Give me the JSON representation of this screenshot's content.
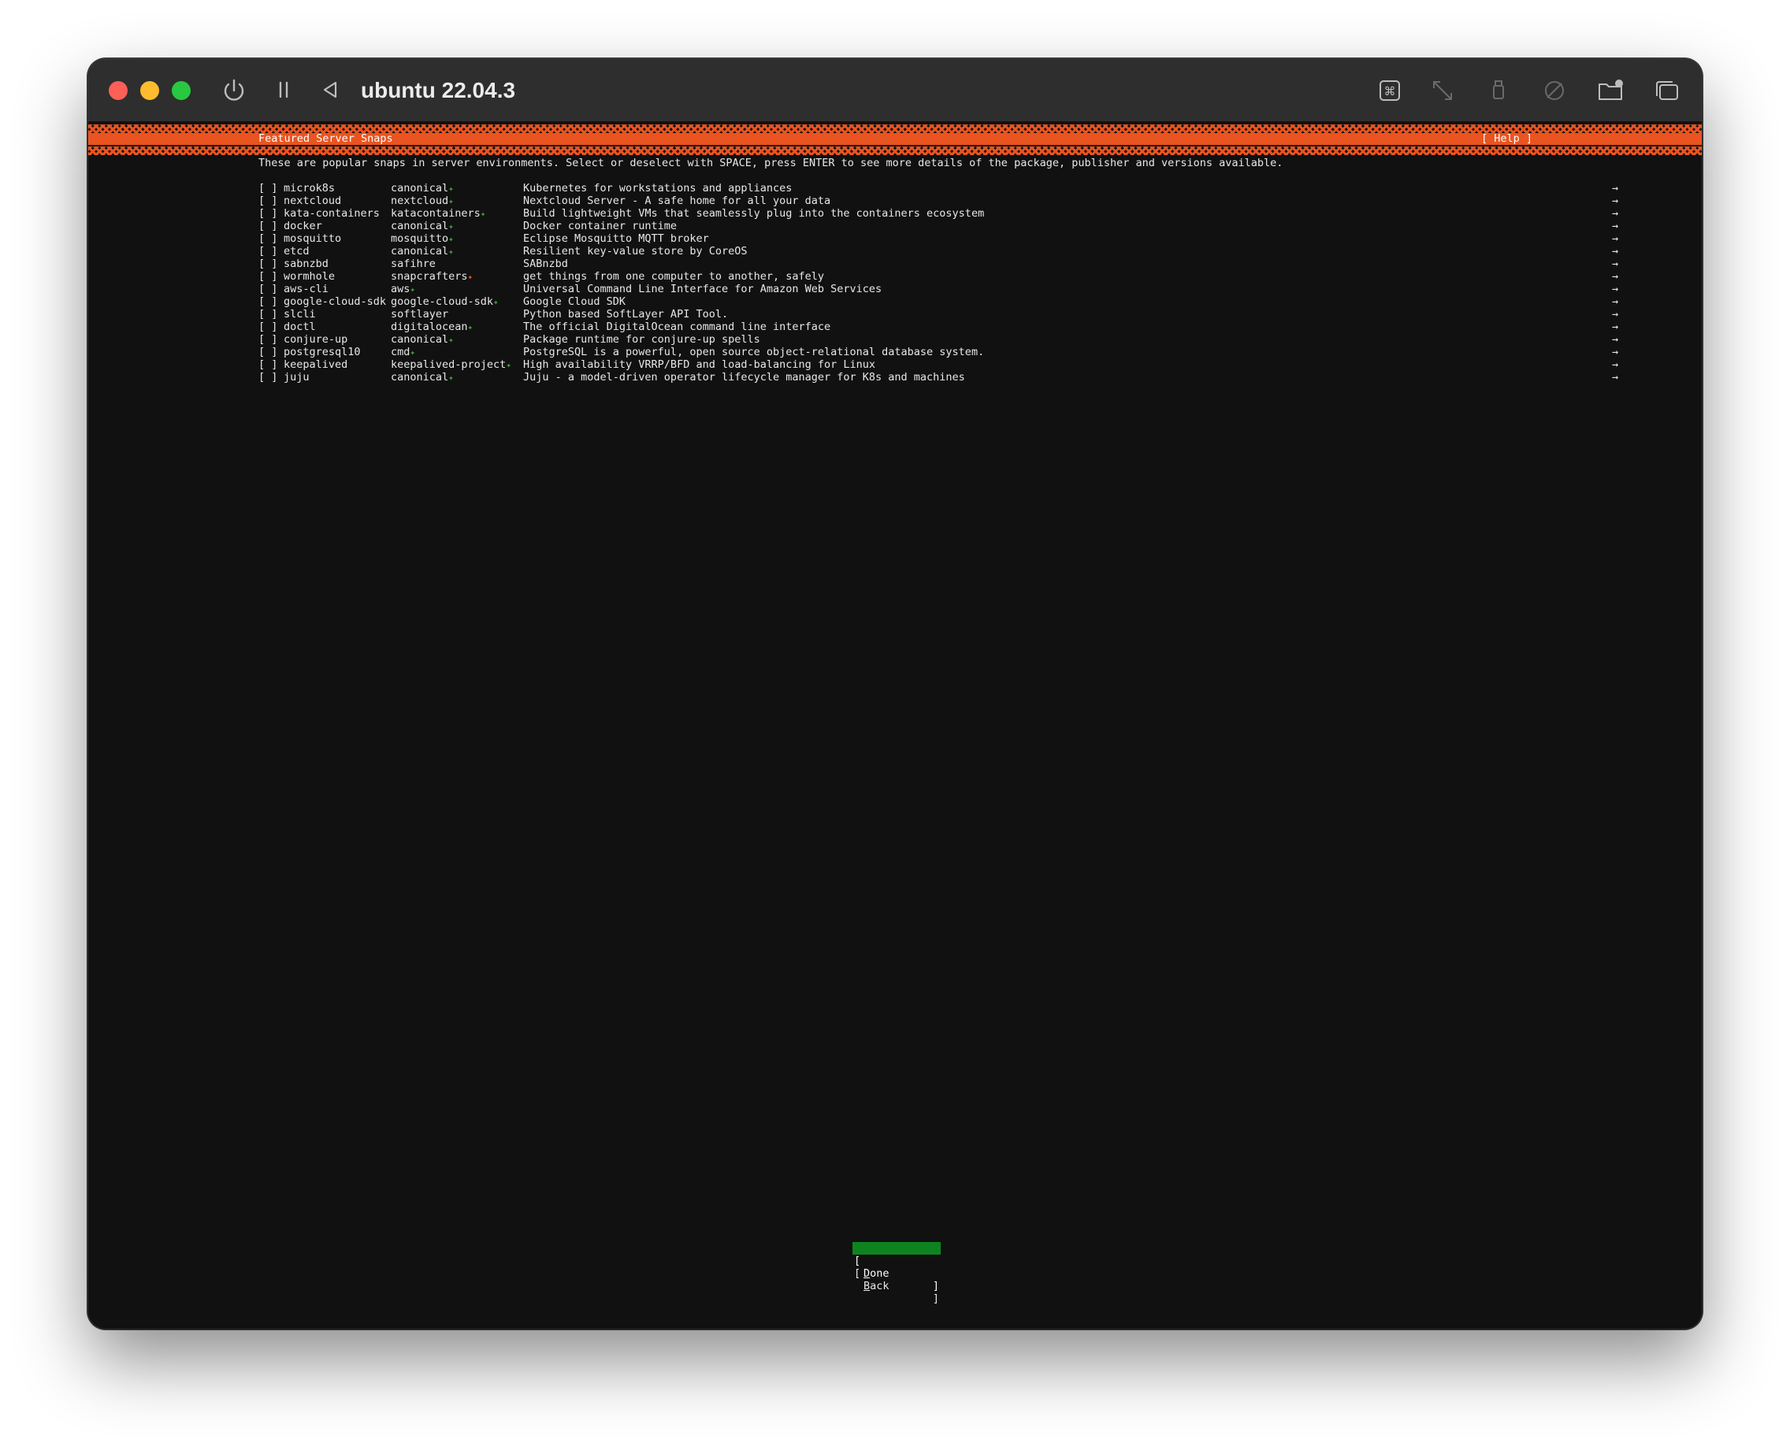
{
  "window": {
    "title": "ubuntu 22.04.3",
    "toolbar_icons": [
      "power-icon",
      "pause-icon",
      "back-triangle-icon",
      "command-key-icon",
      "resize-arrows-icon",
      "usb-icon",
      "network-icon",
      "shared-folder-icon",
      "windows-icon"
    ]
  },
  "screen": {
    "title": "Featured Server Snaps",
    "help": "[ Help ]",
    "intro": "These are popular snaps in server environments. Select or deselect with SPACE, press ENTER to see more details of the package, publisher and versions available.",
    "checkbox": "[ ]",
    "arrow": "→",
    "verified_star": "✦",
    "star_colors": {
      "verified": "#3fa13f",
      "starred": "#e95420"
    },
    "snaps": [
      {
        "name": "microk8s",
        "publisher": "canonical",
        "badge": "verified",
        "description": "Kubernetes for workstations and appliances"
      },
      {
        "name": "nextcloud",
        "publisher": "nextcloud",
        "badge": "verified",
        "description": "Nextcloud Server - A safe home for all your data"
      },
      {
        "name": "kata-containers",
        "publisher": "katacontainers",
        "badge": "verified",
        "description": "Build lightweight VMs that seamlessly plug into the containers ecosystem"
      },
      {
        "name": "docker",
        "publisher": "canonical",
        "badge": "verified",
        "description": "Docker container runtime"
      },
      {
        "name": "mosquitto",
        "publisher": "mosquitto",
        "badge": "verified",
        "description": "Eclipse Mosquitto MQTT broker"
      },
      {
        "name": "etcd",
        "publisher": "canonical",
        "badge": "verified",
        "description": "Resilient key-value store by CoreOS"
      },
      {
        "name": "sabnzbd",
        "publisher": "safihre",
        "badge": "",
        "description": "SABnzbd"
      },
      {
        "name": "wormhole",
        "publisher": "snapcrafters",
        "badge": "starred",
        "description": "get things from one computer to another, safely"
      },
      {
        "name": "aws-cli",
        "publisher": "aws",
        "badge": "verified",
        "description": "Universal Command Line Interface for Amazon Web Services"
      },
      {
        "name": "google-cloud-sdk",
        "publisher": "google-cloud-sdk",
        "badge": "verified",
        "description": "Google Cloud SDK"
      },
      {
        "name": "slcli",
        "publisher": "softlayer",
        "badge": "",
        "description": "Python based SoftLayer API Tool."
      },
      {
        "name": "doctl",
        "publisher": "digitalocean",
        "badge": "verified",
        "description": "The official DigitalOcean command line interface"
      },
      {
        "name": "conjure-up",
        "publisher": "canonical",
        "badge": "verified",
        "description": "Package runtime for conjure-up spells"
      },
      {
        "name": "postgresql10",
        "publisher": "cmd",
        "badge": "verified",
        "description": "PostgreSQL is a powerful, open source object-relational database system."
      },
      {
        "name": "keepalived",
        "publisher": "keepalived-project",
        "badge": "verified",
        "description": "High availability VRRP/BFD and load-balancing for Linux"
      },
      {
        "name": "juju",
        "publisher": "canonical",
        "badge": "verified",
        "description": "Juju - a model-driven operator lifecycle manager for K8s and machines"
      }
    ],
    "buttons": {
      "done": {
        "label_first": "D",
        "label_rest": "one"
      },
      "back": {
        "label_first": "B",
        "label_rest": "ack"
      },
      "left_bracket": "[",
      "right_bracket": "]"
    }
  },
  "colors": {
    "accent_orange": "#e95420",
    "focus_green": "#0e8420",
    "terminal_bg": "#111111",
    "titlebar_bg": "#2e2e2e"
  }
}
